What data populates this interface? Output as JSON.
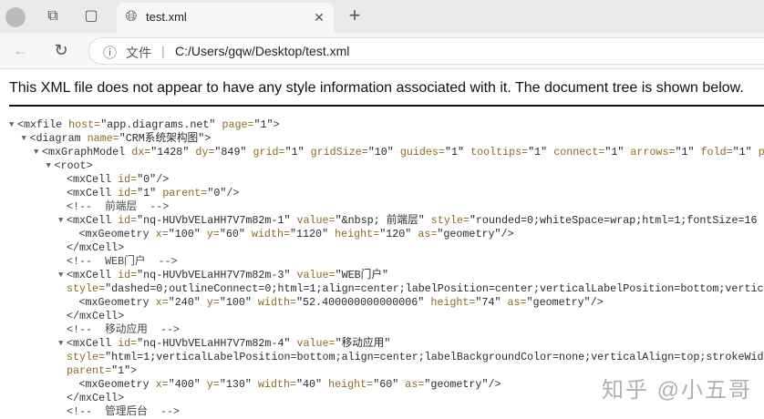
{
  "browser": {
    "tab_title": "test.xml",
    "address_scheme_label": "文件",
    "address_url": "C:/Users/gqw/Desktop/test.xml",
    "icons": [
      "profile-icon",
      "workspaces-icon",
      "vertical-tabs-icon",
      "globe-icon",
      "close-icon",
      "new-tab-icon",
      "back-icon",
      "refresh-icon",
      "info-icon"
    ]
  },
  "notice": "This XML file does not appear to have any style information associated with it. The document tree is shown below.",
  "watermark": "知乎 @小五哥",
  "xml_lines": [
    {
      "indent": 0,
      "toggle": true,
      "tokens": [
        [
          "tag",
          "<mxfile "
        ],
        [
          "an",
          "host="
        ],
        [
          "av",
          "\"app.diagrams.net\" "
        ],
        [
          "an",
          "page="
        ],
        [
          "av",
          "\"1\""
        ],
        [
          "tag",
          ">"
        ]
      ]
    },
    {
      "indent": 1,
      "toggle": true,
      "tokens": [
        [
          "tag",
          "<diagram "
        ],
        [
          "an",
          "name="
        ],
        [
          "av",
          "\"CRM系统架构图\""
        ],
        [
          "tag",
          ">"
        ]
      ]
    },
    {
      "indent": 2,
      "toggle": true,
      "tokens": [
        [
          "tag",
          "<mxGraphModel "
        ],
        [
          "an",
          "dx="
        ],
        [
          "av",
          "\"1428\" "
        ],
        [
          "an",
          "dy="
        ],
        [
          "av",
          "\"849\" "
        ],
        [
          "an",
          "grid="
        ],
        [
          "av",
          "\"1\" "
        ],
        [
          "an",
          "gridSize="
        ],
        [
          "av",
          "\"10\" "
        ],
        [
          "an",
          "guides="
        ],
        [
          "av",
          "\"1\" "
        ],
        [
          "an",
          "tooltips="
        ],
        [
          "av",
          "\"1\" "
        ],
        [
          "an",
          "connect="
        ],
        [
          "av",
          "\"1\" "
        ],
        [
          "an",
          "arrows="
        ],
        [
          "av",
          "\"1\" "
        ],
        [
          "an",
          "fold="
        ],
        [
          "av",
          "\"1\" "
        ],
        [
          "an",
          "p"
        ]
      ]
    },
    {
      "indent": 3,
      "toggle": true,
      "tokens": [
        [
          "tag",
          "<root>"
        ]
      ]
    },
    {
      "indent": 4,
      "toggle": false,
      "tokens": [
        [
          "tag",
          "<mxCell "
        ],
        [
          "an",
          "id="
        ],
        [
          "av",
          "\"0\""
        ],
        [
          "tag",
          "/>"
        ]
      ]
    },
    {
      "indent": 4,
      "toggle": false,
      "tokens": [
        [
          "tag",
          "<mxCell "
        ],
        [
          "an",
          "id="
        ],
        [
          "av",
          "\"1\" "
        ],
        [
          "an",
          "parent="
        ],
        [
          "av",
          "\"0\""
        ],
        [
          "tag",
          "/>"
        ]
      ]
    },
    {
      "indent": 4,
      "toggle": false,
      "tokens": [
        [
          "cm",
          "<!--  前端层  -->"
        ]
      ]
    },
    {
      "indent": 4,
      "toggle": true,
      "tokens": [
        [
          "tag",
          "<mxCell "
        ],
        [
          "an",
          "id="
        ],
        [
          "av",
          "\"nq-HUVbVELaHH7V7m82m-1\" "
        ],
        [
          "an",
          "value="
        ],
        [
          "av",
          "\"&nbsp; 前端层\" "
        ],
        [
          "an",
          "style="
        ],
        [
          "av",
          "\"rounded=0;whiteSpace=wrap;html=1;fontSize=16"
        ]
      ]
    },
    {
      "indent": 5,
      "toggle": false,
      "tokens": [
        [
          "tag",
          "<mxGeometry "
        ],
        [
          "an",
          "x="
        ],
        [
          "av",
          "\"100\" "
        ],
        [
          "an",
          "y="
        ],
        [
          "av",
          "\"60\" "
        ],
        [
          "an",
          "width="
        ],
        [
          "av",
          "\"1120\" "
        ],
        [
          "an",
          "height="
        ],
        [
          "av",
          "\"120\" "
        ],
        [
          "an",
          "as="
        ],
        [
          "av",
          "\"geometry\""
        ],
        [
          "tag",
          "/>"
        ]
      ]
    },
    {
      "indent": 4,
      "toggle": false,
      "tokens": [
        [
          "tag",
          "</mxCell>"
        ]
      ]
    },
    {
      "indent": 4,
      "toggle": false,
      "tokens": [
        [
          "cm",
          "<!--  WEB门户  -->"
        ]
      ]
    },
    {
      "indent": 4,
      "toggle": true,
      "tokens": [
        [
          "tag",
          "<mxCell "
        ],
        [
          "an",
          "id="
        ],
        [
          "av",
          "\"nq-HUVbVELaHH7V7m82m-3\" "
        ],
        [
          "an",
          "value="
        ],
        [
          "av",
          "\"WEB门户\""
        ]
      ]
    },
    {
      "indent": 4,
      "toggle": false,
      "tokens": [
        [
          "an",
          "style="
        ],
        [
          "av",
          "\"dashed=0;outlineConnect=0;html=1;align=center;labelPosition=center;verticalLabelPosition=bottom;vertica"
        ]
      ]
    },
    {
      "indent": 5,
      "toggle": false,
      "tokens": [
        [
          "tag",
          "<mxGeometry "
        ],
        [
          "an",
          "x="
        ],
        [
          "av",
          "\"240\" "
        ],
        [
          "an",
          "y="
        ],
        [
          "av",
          "\"100\" "
        ],
        [
          "an",
          "width="
        ],
        [
          "av",
          "\"52.400000000000006\" "
        ],
        [
          "an",
          "height="
        ],
        [
          "av",
          "\"74\" "
        ],
        [
          "an",
          "as="
        ],
        [
          "av",
          "\"geometry\""
        ],
        [
          "tag",
          "/>"
        ]
      ]
    },
    {
      "indent": 4,
      "toggle": false,
      "tokens": [
        [
          "tag",
          "</mxCell>"
        ]
      ]
    },
    {
      "indent": 4,
      "toggle": false,
      "tokens": [
        [
          "cm",
          "<!--  移动应用  -->"
        ]
      ]
    },
    {
      "indent": 4,
      "toggle": true,
      "tokens": [
        [
          "tag",
          "<mxCell "
        ],
        [
          "an",
          "id="
        ],
        [
          "av",
          "\"nq-HUVbVELaHH7V7m82m-4\" "
        ],
        [
          "an",
          "value="
        ],
        [
          "av",
          "\"移动应用\""
        ]
      ]
    },
    {
      "indent": 4,
      "toggle": false,
      "tokens": [
        [
          "an",
          "style="
        ],
        [
          "av",
          "\"html=1;verticalLabelPosition=bottom;align=center;labelBackgroundColor=none;verticalAlign=top;strokeWidt"
        ]
      ]
    },
    {
      "indent": 4,
      "toggle": false,
      "tokens": [
        [
          "an",
          "parent="
        ],
        [
          "av",
          "\"1\""
        ],
        [
          "tag",
          ">"
        ]
      ]
    },
    {
      "indent": 5,
      "toggle": false,
      "tokens": [
        [
          "tag",
          "<mxGeometry "
        ],
        [
          "an",
          "x="
        ],
        [
          "av",
          "\"400\" "
        ],
        [
          "an",
          "y="
        ],
        [
          "av",
          "\"130\" "
        ],
        [
          "an",
          "width="
        ],
        [
          "av",
          "\"40\" "
        ],
        [
          "an",
          "height="
        ],
        [
          "av",
          "\"60\" "
        ],
        [
          "an",
          "as="
        ],
        [
          "av",
          "\"geometry\""
        ],
        [
          "tag",
          "/>"
        ]
      ]
    },
    {
      "indent": 4,
      "toggle": false,
      "tokens": [
        [
          "tag",
          "</mxCell>"
        ]
      ]
    },
    {
      "indent": 4,
      "toggle": false,
      "tokens": [
        [
          "cm",
          "<!--  管理后台  -->"
        ]
      ]
    }
  ]
}
